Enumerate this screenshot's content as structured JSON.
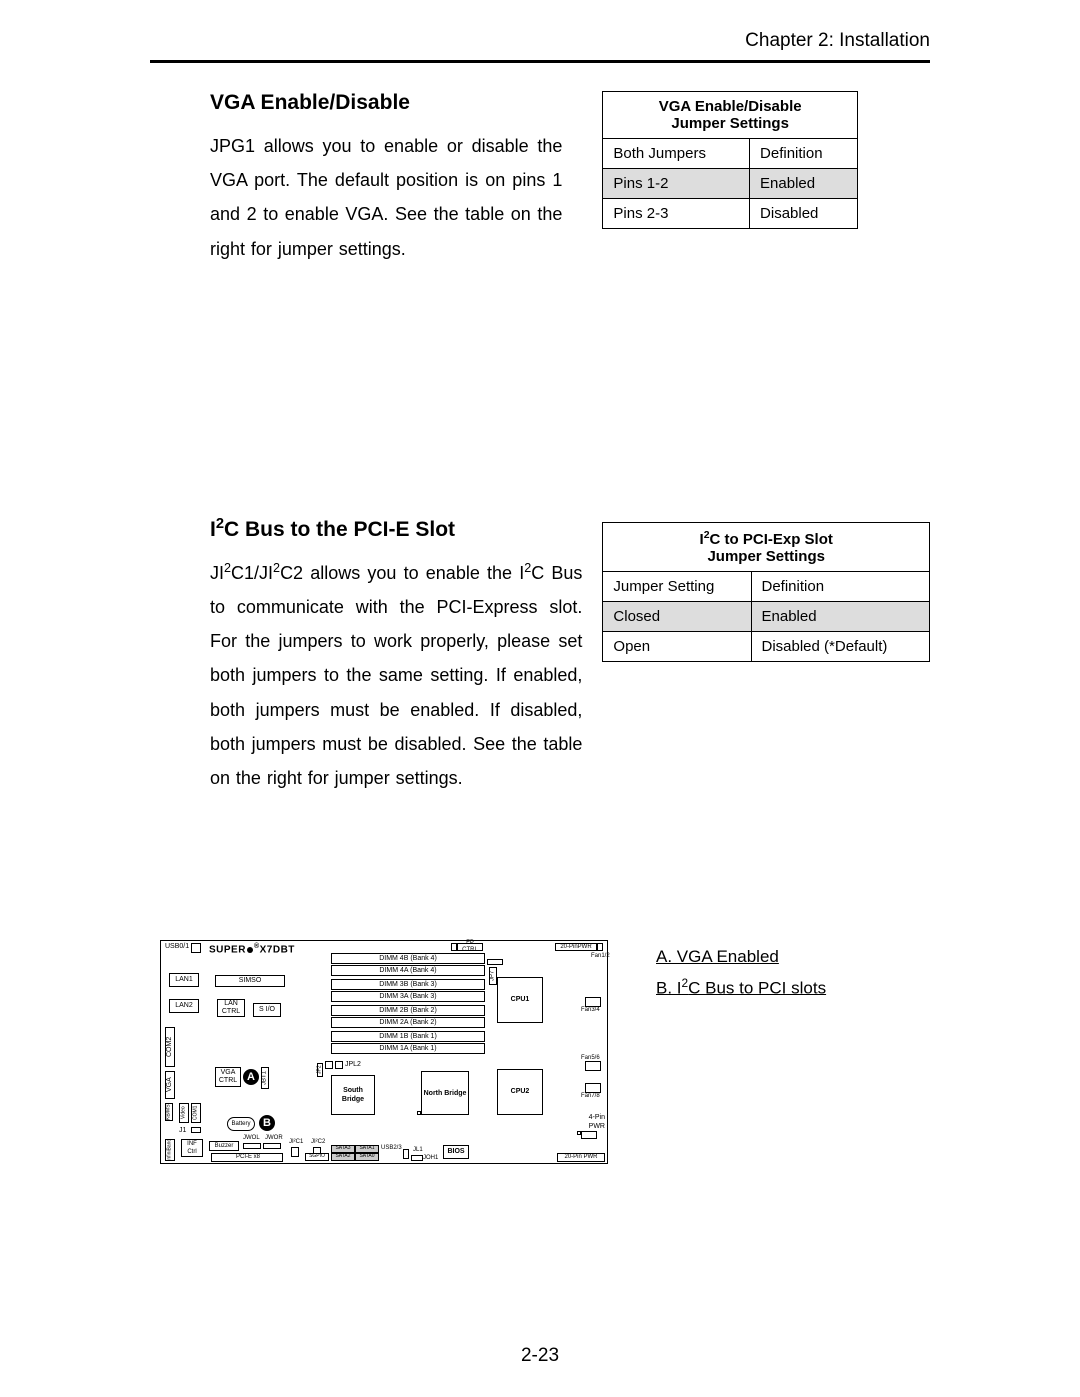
{
  "chapter": "Chapter 2: Installation",
  "section1": {
    "title": "VGA Enable/Disable",
    "body": "JPG1 allows you to enable or disable the VGA port.  The default position is on pins 1 and 2 to enable VGA.  See the table on the right for jumper settings.",
    "table_title1": "VGA Enable/Disable",
    "table_title2": "Jumper Settings",
    "h1": "Both Jumpers",
    "h2": "Definition",
    "r1c1": "Pins 1-2",
    "r1c2": "Enabled",
    "r2c1": "Pins 2-3",
    "r2c2": "Disabled"
  },
  "section2": {
    "title_pre": "I",
    "title_sup": "2",
    "title_post": "C Bus to the PCI-E Slot",
    "body_1": "JI",
    "body_2": "C1/JI",
    "body_3": "C2 allows you to enable the I",
    "body_4": "C Bus to communicate with the PCI-Express slot. For the jumpers to work properly, please set both jumpers to the same setting. If enabled, both jumpers must be enabled. If disabled, both jumpers must be disabled. See the table on the right for jumper settings.",
    "table_title_pre": "I",
    "table_title_sup": "2",
    "table_title_post": "C to PCI-Exp Slot",
    "table_title2": "Jumper Settings",
    "h1": "Jumper Setting",
    "h2": "Definition",
    "r1c1": "Closed",
    "r1c2": "Enabled",
    "r2c1": "Open",
    "r2c2": "Disabled (*Default)"
  },
  "legend": {
    "a": "A. VGA Enabled",
    "b_pre": "B. I",
    "b_sup": "2",
    "b_post": "C Bus to PCI slots"
  },
  "board": {
    "brand_pre": "SUPER",
    "brand_post": "X7DBT",
    "usb01": "USB0/1",
    "fpctrl": "FP CTRL",
    "pwr20": "20-PinPWR",
    "fan12": "Fan1/2",
    "dimm4b": "DIMM 4B (Bank 4)",
    "dimm4a": "DIMM 4A (Bank 4)",
    "dimm3b": "DIMM 3B (Bank 3)",
    "dimm3a": "DIMM 3A (Bank 3)",
    "dimm2b": "DIMM 2B (Bank 2)",
    "dimm2a": "DIMM 2A (Bank 2)",
    "dimm1b": "DIMM 1B (Bank 1)",
    "dimm1a": "DIMM 1A (Bank 1)",
    "lan1": "LAN1",
    "lan2": "LAN2",
    "simso": "SIMSO",
    "lanctrl": "LAN CTRL",
    "sio": "S I/O",
    "cpu1": "CPU1",
    "cpu2": "CPU2",
    "fan34": "Fan3/4",
    "fan56": "Fan5/6",
    "fan78": "Fan7/8",
    "vga": "VGA",
    "com2": "COM2",
    "vgactrl": "VGA CTRL",
    "jbt1": "JBT1",
    "jp2": "JP2",
    "jpl2": "JPL2",
    "north": "North Bridge",
    "south": "South Bridge",
    "fourpin": "4-Pin PWR",
    "kbms": "KB/MS",
    "video": "Video",
    "com1": "COM1",
    "j1": "J1",
    "infini": "InfiniBand",
    "inf": "INF Ctrl",
    "buzzer": "Buzzer",
    "battery": "Battery",
    "wol": "JWOL",
    "wor": "JWOR",
    "ji2c1": "JI²C1",
    "ji2c2": "JI²C2",
    "sgpio": "SGPIO",
    "sata0": "SATA0",
    "sata1": "SATA1",
    "sata2": "SATA2",
    "sata3": "SATA3",
    "usb23": "USB2/3",
    "jl1": "JL1",
    "joh1": "JOH1",
    "bios": "BIOS",
    "pciex8": "PCI-E x8",
    "pwr20b": "20-Pin  PWR",
    "markerA": "A",
    "markerB": "B"
  },
  "page_num": "2-23"
}
